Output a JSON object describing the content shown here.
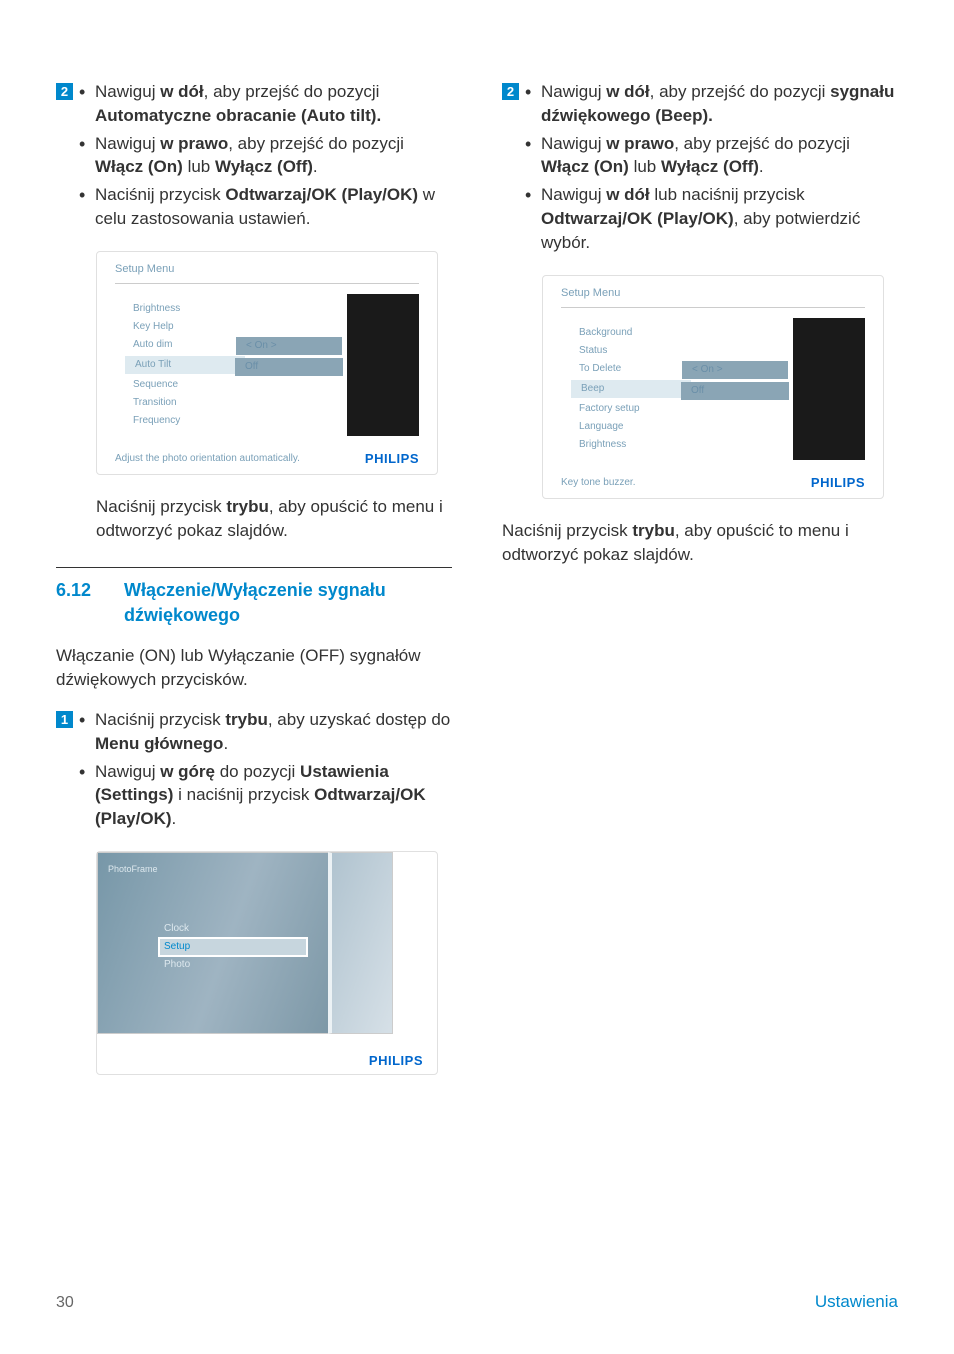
{
  "left": {
    "step2": {
      "num": "2",
      "items": [
        {
          "pre": "Nawiguj ",
          "b1": "w dół",
          "mid": ", aby przejść do pozycji ",
          "b2": "Automatyczne obracanie (Auto tilt)."
        },
        {
          "pre": "Nawiguj ",
          "b1": "w prawo",
          "mid": ", aby przejść do pozycji ",
          "b2": "Włącz (On)",
          "mid2": " lub ",
          "b3": "Wyłącz (Off)",
          "mid3": "."
        },
        {
          "pre": "Naciśnij przycisk ",
          "b1": "Odtwarzaj/OK (Play/OK)",
          "mid": " w celu zastosowania ustawień."
        }
      ]
    },
    "fig1": {
      "title": "Setup Menu",
      "items": [
        "Brightness",
        "Key Help",
        "Auto dim",
        "Auto Tilt",
        "Sequence",
        "Transition",
        "Frequency"
      ],
      "selectedIndex": 3,
      "options": [
        "< On >",
        "Off"
      ],
      "help": "Adjust the photo orientation automatically.",
      "brand": "PHILIPS"
    },
    "after1": "Naciśnij przycisk trybu, aby opuścić to menu i odtworzyć pokaz slajdów.",
    "after1_bold": "trybu",
    "section": {
      "num": "6.12",
      "title": "Włączenie/Wyłączenie sygnału dźwiękowego",
      "intro": "Włączanie (ON) lub Wyłączanie (OFF) sygnałów dźwiękowych przycisków."
    },
    "step1": {
      "num": "1",
      "items": [
        {
          "pre": "Naciśnij przycisk ",
          "b1": "trybu",
          "mid": ", aby uzyskać dostęp do ",
          "b2": "Menu głównego",
          "mid2": "."
        },
        {
          "pre": "Nawiguj ",
          "b1": "w górę",
          "mid": " do pozycji ",
          "b2": "Ustawienia (Settings)",
          "mid2": " i naciśnij przycisk ",
          "b3": "Odtwarzaj/OK (Play/OK)",
          "mid3": "."
        }
      ]
    },
    "fig2": {
      "pflabel": "PhotoFrame",
      "items": [
        "Clock",
        "Setup",
        "Photo"
      ],
      "selectedIndex": 1,
      "brand": "PHILIPS"
    }
  },
  "right": {
    "step2": {
      "num": "2",
      "items": [
        {
          "pre": "Nawiguj ",
          "b1": "w dół",
          "mid": ", aby przejść do pozycji ",
          "b2": "sygnału dźwiękowego (Beep)."
        },
        {
          "pre": "Nawiguj ",
          "b1": "w prawo",
          "mid": ", aby przejść do pozycji ",
          "b2": "Włącz (On)",
          "mid2": " lub ",
          "b3": "Wyłącz (Off)",
          "mid3": "."
        },
        {
          "pre": "Nawiguj ",
          "b1": "w dół",
          "mid": " lub naciśnij przycisk ",
          "b2": "Odtwarzaj/OK (Play/OK)",
          "mid2": ", aby potwierdzić wybór."
        }
      ]
    },
    "fig3": {
      "title": "Setup Menu",
      "items": [
        "Background",
        "Status",
        "To Delete",
        "Beep",
        "Factory setup",
        "Language",
        "Brightness"
      ],
      "selectedIndex": 3,
      "options": [
        "< On >",
        "Off"
      ],
      "help": "Key tone buzzer.",
      "brand": "PHILIPS"
    },
    "after1": "Naciśnij przycisk trybu, aby opuścić to menu i odtworzyć pokaz slajdów.",
    "after1_bold": "trybu"
  },
  "footer": {
    "page": "30",
    "label": "Ustawienia"
  }
}
